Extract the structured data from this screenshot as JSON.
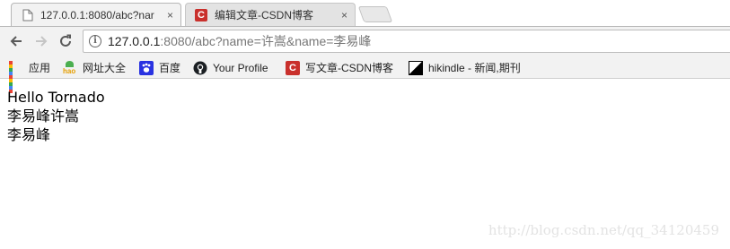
{
  "tabs": [
    {
      "title": "127.0.0.1:8080/abc?nar",
      "active": true,
      "close": "×"
    },
    {
      "title": "编辑文章-CSDN博客",
      "active": false,
      "close": "×"
    }
  ],
  "toolbar": {
    "url_host": "127.0.0.1",
    "url_rest": ":8080/abc?name=许嵩&name=李易峰"
  },
  "bookmarks": [
    {
      "label": "应用",
      "icon": "apps-icon"
    },
    {
      "label": "网址大全",
      "icon": "hao-icon"
    },
    {
      "label": "百度",
      "icon": "baidu-paw-icon"
    },
    {
      "label": "Your Profile",
      "icon": "github-icon"
    },
    {
      "label": "写文章-CSDN博客",
      "icon": "csdn-icon"
    },
    {
      "label": "hikindle - 新闻,期刊",
      "icon": "hikindle-icon"
    }
  ],
  "page": {
    "lines": [
      "Hello Tornado",
      "李易峰许嵩",
      "李易峰"
    ]
  },
  "watermark": "http://blog.csdn.net/qq_34120459",
  "colors": {
    "csdn_red": "#c9302c",
    "baidu_blue": "#2932e1",
    "chrome_toolbar": "#f2f2f2"
  }
}
